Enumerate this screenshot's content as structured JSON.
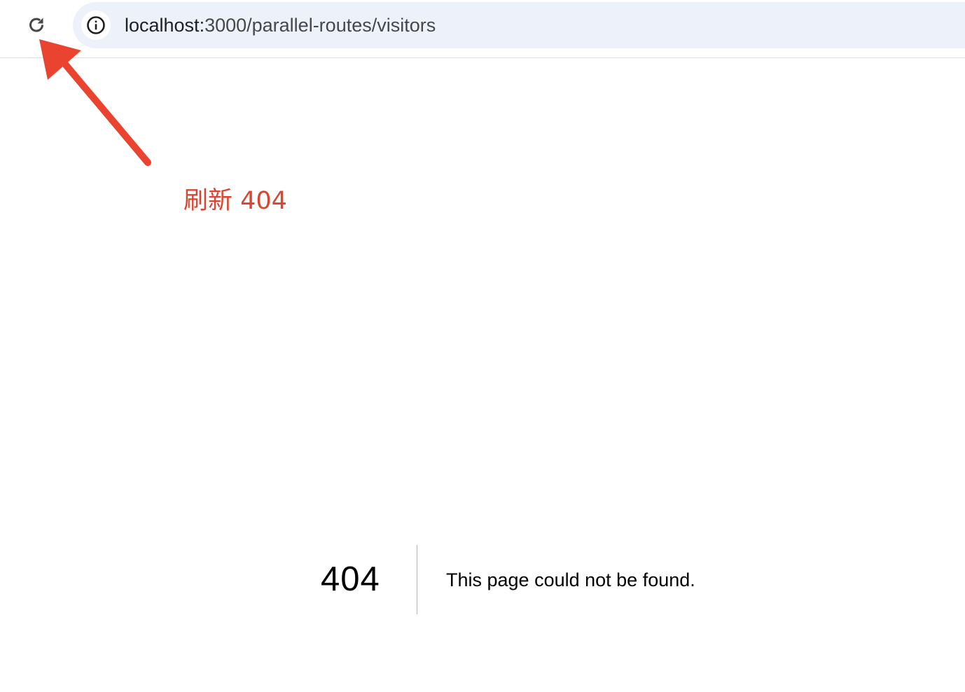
{
  "browser": {
    "reload_icon": "reload-icon",
    "site_info_icon": "info-icon",
    "url_host": "localhost:",
    "url_path": "3000/parallel-routes/visitors"
  },
  "annotation": {
    "text": "刷新 404",
    "color": "#d94530"
  },
  "error_page": {
    "code": "404",
    "message": "This page could not be found."
  }
}
